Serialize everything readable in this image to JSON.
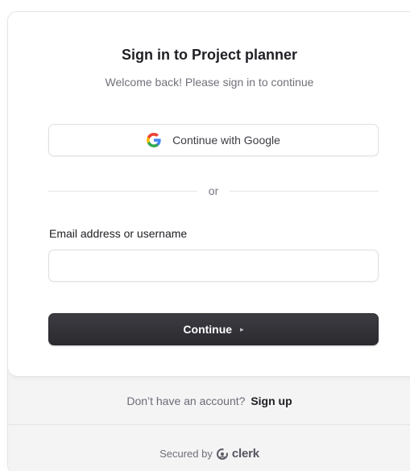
{
  "header": {
    "title": "Sign in to Project planner",
    "subtitle": "Welcome back! Please sign in to continue"
  },
  "social": {
    "google_label": "Continue with Google",
    "icon": "google-icon"
  },
  "divider": {
    "text": "or"
  },
  "form": {
    "email_label": "Email address or username",
    "email_value": "",
    "email_placeholder": "",
    "continue_label": "Continue",
    "continue_icon": "▸"
  },
  "footer": {
    "signup_prompt": "Don’t have an account?",
    "signup_link": "Sign up",
    "secured_by": "Secured by",
    "brand": "clerk"
  },
  "colors": {
    "primary_button": "#2f2f34",
    "card_background": "#ffffff",
    "footer_background": "#f4f4f5"
  }
}
